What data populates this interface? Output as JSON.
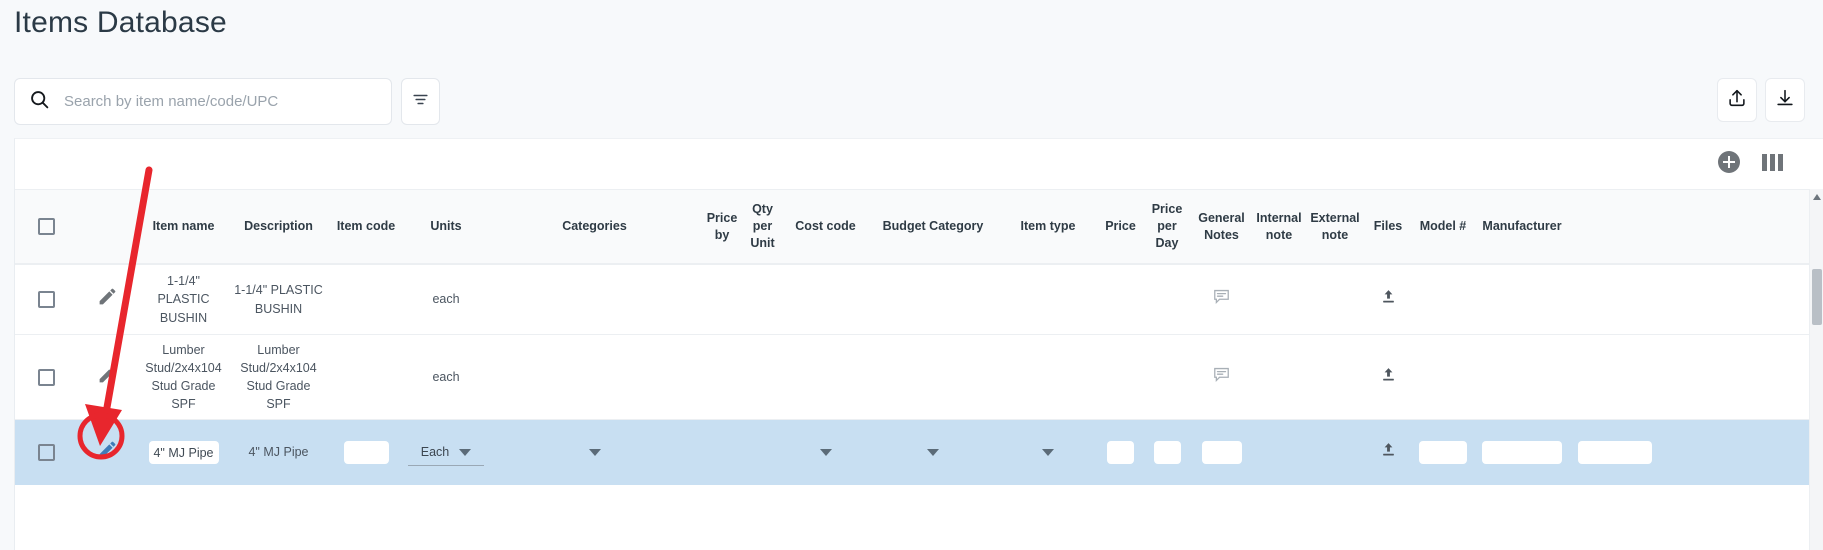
{
  "page": {
    "title": "Items Database"
  },
  "search": {
    "placeholder": "Search by item name/code/UPC",
    "value": "",
    "icon": "search-icon",
    "filter_icon": "filter-icon"
  },
  "actions": {
    "upload_icon": "upload-icon",
    "download_icon": "download-icon",
    "add_icon": "plus-circle-icon",
    "columns_icon": "columns-icon"
  },
  "table": {
    "columns": [
      {
        "key": "select",
        "label": ""
      },
      {
        "key": "edit",
        "label": ""
      },
      {
        "key": "item_name",
        "label": "Item name"
      },
      {
        "key": "description",
        "label": "Description"
      },
      {
        "key": "item_code",
        "label": "Item code"
      },
      {
        "key": "units",
        "label": "Units"
      },
      {
        "key": "categories",
        "label": "Categories"
      },
      {
        "key": "price_by",
        "label": "Price by"
      },
      {
        "key": "qty_per_unit",
        "label": "Qty per Unit"
      },
      {
        "key": "cost_code",
        "label": "Cost code"
      },
      {
        "key": "budget_cat",
        "label": "Budget Category"
      },
      {
        "key": "item_type",
        "label": "Item type"
      },
      {
        "key": "price",
        "label": "Price"
      },
      {
        "key": "price_per_day",
        "label": "Price per Day"
      },
      {
        "key": "general_notes",
        "label": "General Notes"
      },
      {
        "key": "internal_note",
        "label": "Internal note"
      },
      {
        "key": "external_note",
        "label": "External note"
      },
      {
        "key": "files",
        "label": "Files"
      },
      {
        "key": "model",
        "label": "Model #"
      },
      {
        "key": "manufacturer",
        "label": "Manufacturer"
      },
      {
        "key": "last",
        "label": ""
      }
    ],
    "rows": [
      {
        "selected": false,
        "editing": false,
        "item_name": "1-1/4\" PLASTIC BUSHIN",
        "description": "1-1/4\" PLASTIC BUSHIN",
        "item_code": "",
        "units": "each",
        "categories": "",
        "price_by": "",
        "qty_per_unit": "",
        "cost_code": "",
        "budget_cat": "",
        "item_type": "",
        "price": "",
        "price_per_day": "",
        "general_notes_icon": "comment-icon",
        "internal_note": "",
        "external_note": "",
        "files_icon": "upload-icon",
        "model": "",
        "manufacturer": ""
      },
      {
        "selected": false,
        "editing": false,
        "item_name": "Lumber Stud/2x4x104 Stud Grade SPF",
        "description": "Lumber Stud/2x4x104 Stud Grade SPF",
        "item_code": "",
        "units": "each",
        "categories": "",
        "price_by": "",
        "qty_per_unit": "",
        "cost_code": "",
        "budget_cat": "",
        "item_type": "",
        "price": "",
        "price_per_day": "",
        "general_notes_icon": "comment-icon",
        "internal_note": "",
        "external_note": "",
        "files_icon": "upload-icon",
        "model": "",
        "manufacturer": ""
      },
      {
        "selected": true,
        "editing": true,
        "item_name": "4\" MJ Pipe",
        "description": "4\" MJ Pipe",
        "item_code": "",
        "units": "Each",
        "categories": "",
        "price_by": "",
        "qty_per_unit": "",
        "cost_code": "",
        "budget_cat": "",
        "item_type": "",
        "price": "",
        "price_per_day": "",
        "general_notes": "",
        "internal_note": "",
        "external_note": "",
        "files_icon": "upload-icon",
        "model": "",
        "manufacturer": ""
      }
    ]
  },
  "scrollbar": {
    "up_arrow_icon": "caret-up-icon"
  },
  "colors": {
    "selected_row": "#c8dff2",
    "annotation": "#e8262d",
    "header_bg": "#f9fafb",
    "page_bg": "#f7f9fb",
    "edit_pencil_active": "#3f7cb8"
  }
}
